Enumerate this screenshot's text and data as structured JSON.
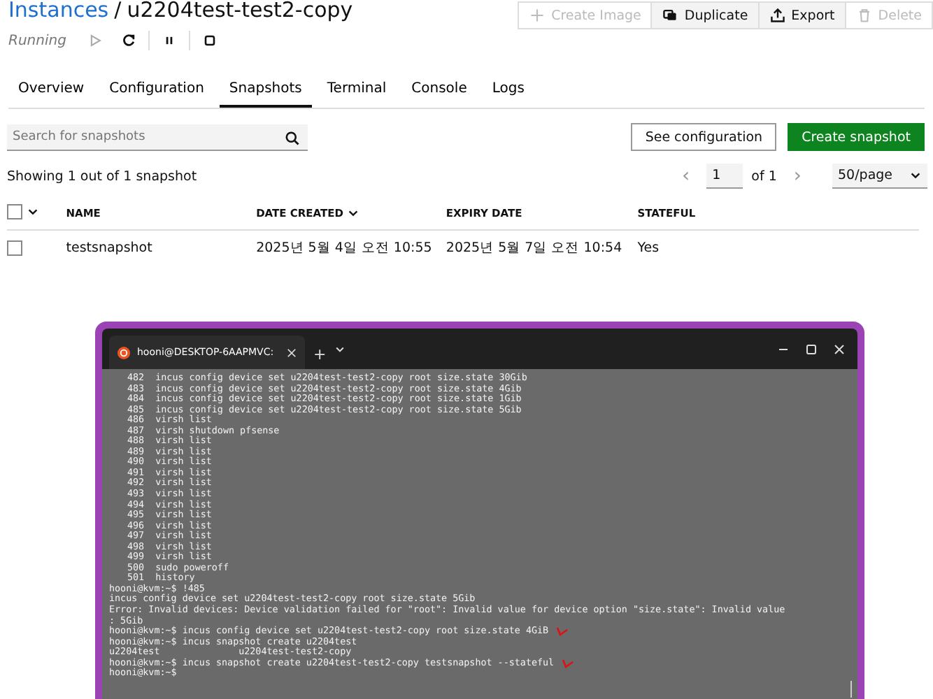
{
  "breadcrumb": {
    "parent": "Instances",
    "separator": "/",
    "current": "u2204test-test2-copy"
  },
  "status": {
    "label": "Running",
    "controls": [
      {
        "kind": "start",
        "disabled": true
      },
      {
        "kind": "restart",
        "disabled": false
      },
      {
        "kind": "pause",
        "disabled": false
      },
      {
        "kind": "stop",
        "disabled": false
      }
    ]
  },
  "actions": [
    {
      "kind": "plus",
      "label": "Create Image",
      "disabled": true
    },
    {
      "kind": "duplicate",
      "label": "Duplicate",
      "disabled": false
    },
    {
      "kind": "export",
      "label": "Export",
      "disabled": false
    },
    {
      "kind": "trash",
      "label": "Delete",
      "disabled": true
    }
  ],
  "tabs": [
    {
      "label": "Overview",
      "selected": false
    },
    {
      "label": "Configuration",
      "selected": false
    },
    {
      "label": "Snapshots",
      "selected": true
    },
    {
      "label": "Terminal",
      "selected": false
    },
    {
      "label": "Console",
      "selected": false
    },
    {
      "label": "Logs",
      "selected": false
    }
  ],
  "search": {
    "placeholder": "Search for snapshots"
  },
  "buttons": [
    {
      "label": "See configuration",
      "kind": "secondary"
    },
    {
      "label": "Create snapshot",
      "kind": "primary"
    }
  ],
  "summary": "Showing 1 out of 1 snapshot",
  "pagination": {
    "page": "1",
    "of": "of 1",
    "prev": "‹",
    "next": "›",
    "page_size": "50/page"
  },
  "table": {
    "select_all_checked": false,
    "columns": [
      {
        "label": "NAME",
        "sorted": false
      },
      {
        "label": "DATE CREATED",
        "sorted": true
      },
      {
        "label": "EXPIRY DATE",
        "sorted": false
      },
      {
        "label": "STATEFUL",
        "sorted": false
      }
    ],
    "rows": [
      {
        "checked": false,
        "cells": [
          "testsnapshot",
          "2025년 5월 4일 오전 10:55",
          "2025년 5월 7일 오전 10:54",
          "Yes"
        ]
      }
    ]
  },
  "terminal": {
    "tab_title": "hooni@DESKTOP-6AAPMVC:",
    "new_tab": "+",
    "lines": [
      {
        "kind": "history",
        "text": "482  incus config device set u2204test-test2-copy root size.state 30Gib",
        "annotated": false
      },
      {
        "kind": "history",
        "text": "483  incus config device set u2204test-test2-copy root size.state 4Gib",
        "annotated": false
      },
      {
        "kind": "history",
        "text": "484  incus config device set u2204test-test2-copy root size.state 1Gib",
        "annotated": false
      },
      {
        "kind": "history",
        "text": "485  incus config device set u2204test-test2-copy root size.state 5Gib",
        "annotated": false
      },
      {
        "kind": "history",
        "text": "486  virsh list",
        "annotated": false
      },
      {
        "kind": "history",
        "text": "487  virsh shutdown pfsense",
        "annotated": false
      },
      {
        "kind": "history",
        "text": "488  virsh list",
        "annotated": false
      },
      {
        "kind": "history",
        "text": "489  virsh list",
        "annotated": false
      },
      {
        "kind": "history",
        "text": "490  virsh list",
        "annotated": false
      },
      {
        "kind": "history",
        "text": "491  virsh list",
        "annotated": false
      },
      {
        "kind": "history",
        "text": "492  virsh list",
        "annotated": false
      },
      {
        "kind": "history",
        "text": "493  virsh list",
        "annotated": false
      },
      {
        "kind": "history",
        "text": "494  virsh list",
        "annotated": false
      },
      {
        "kind": "history",
        "text": "495  virsh list",
        "annotated": false
      },
      {
        "kind": "history",
        "text": "496  virsh list",
        "annotated": false
      },
      {
        "kind": "history",
        "text": "497  virsh list",
        "annotated": false
      },
      {
        "kind": "history",
        "text": "498  virsh list",
        "annotated": false
      },
      {
        "kind": "history",
        "text": "499  virsh list",
        "annotated": false
      },
      {
        "kind": "history",
        "text": "500  sudo poweroff",
        "annotated": false
      },
      {
        "kind": "history",
        "text": "501  history",
        "annotated": false
      },
      {
        "kind": "plain",
        "text": "hooni@kvm:~$ !485",
        "annotated": false
      },
      {
        "kind": "plain",
        "text": "incus config device set u2204test-test2-copy root size.state 5Gib",
        "annotated": false
      },
      {
        "kind": "plain",
        "text": "Error: Invalid devices: Device validation failed for \"root\": Invalid value for device option \"size.state\": Invalid value",
        "annotated": false
      },
      {
        "kind": "plain",
        "text": ": 5Gib",
        "annotated": false
      },
      {
        "kind": "plain",
        "text": "hooni@kvm:~$ incus config device set u2204test-test2-copy root size.state 4GiB",
        "annotated": true
      },
      {
        "kind": "plain",
        "text": "hooni@kvm:~$ incus snapshot create u2204test",
        "annotated": false
      },
      {
        "kind": "plain",
        "text": "u2204test              u2204test-test2-copy",
        "annotated": false
      },
      {
        "kind": "plain",
        "text": "hooni@kvm:~$ incus snapshot create u2204test-test2-copy testsnapshot --stateful",
        "annotated": true
      },
      {
        "kind": "plain",
        "text": "hooni@kvm:~$",
        "annotated": false
      }
    ]
  }
}
